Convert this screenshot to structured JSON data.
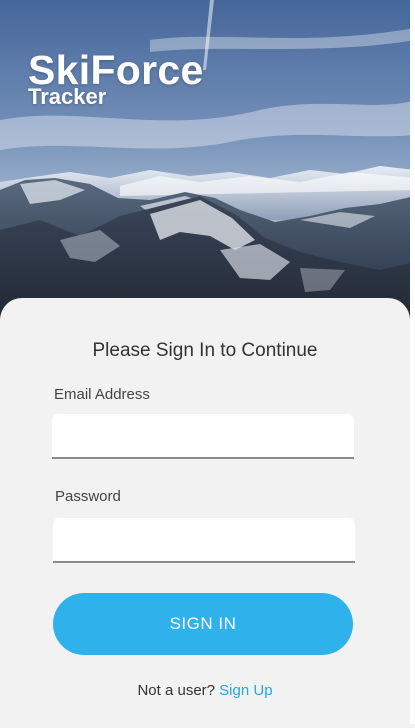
{
  "app": {
    "brand_name": "SkiForce",
    "brand_sub": "Tracker"
  },
  "login": {
    "heading": "Please Sign In to Continue",
    "email_label": "Email Address",
    "email_value": "",
    "password_label": "Password",
    "password_value": "",
    "signin_label": "SIGN IN",
    "signup_prompt": "Not a user?",
    "signup_link": "Sign Up"
  },
  "colors": {
    "accent": "#2fb1ec",
    "link": "#2aa6e0",
    "card_background": "#f2f2f2"
  },
  "background": {
    "image_description": "snowy mountain range under a blue sky",
    "icon": "mountain-photo"
  }
}
